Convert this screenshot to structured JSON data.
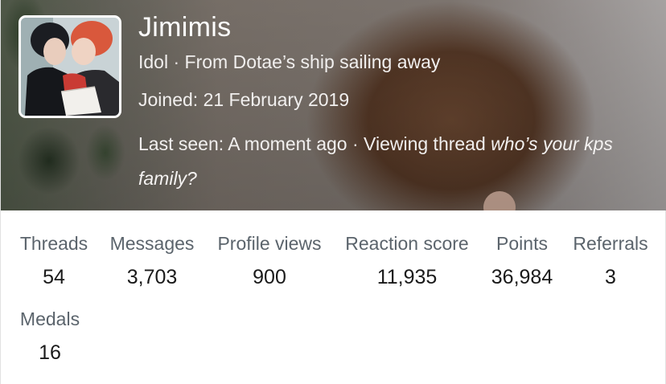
{
  "profile": {
    "username": "Jimimis",
    "title": "Idol",
    "location": "From Dotae’s ship sailing away",
    "joined_label": "Joined:",
    "joined_date": "21 February 2019",
    "last_seen_label": "Last seen:",
    "last_seen_time": "A moment ago",
    "activity": "Viewing thread",
    "thread_title": "who’s your kps family?",
    "separator": "·"
  },
  "stats": [
    {
      "label": "Threads",
      "value": "54"
    },
    {
      "label": "Messages",
      "value": "3,703"
    },
    {
      "label": "Profile views",
      "value": "900"
    },
    {
      "label": "Reaction score",
      "value": "11,935"
    },
    {
      "label": "Points",
      "value": "36,984"
    },
    {
      "label": "Referrals",
      "value": "3"
    },
    {
      "label": "Medals",
      "value": "16"
    }
  ],
  "colors": {
    "label_gray": "#5b646c",
    "value_dark": "#1a1a1a",
    "banner_text": "#ffffff"
  },
  "icons": [
    "avatar-image",
    "banner-image"
  ]
}
